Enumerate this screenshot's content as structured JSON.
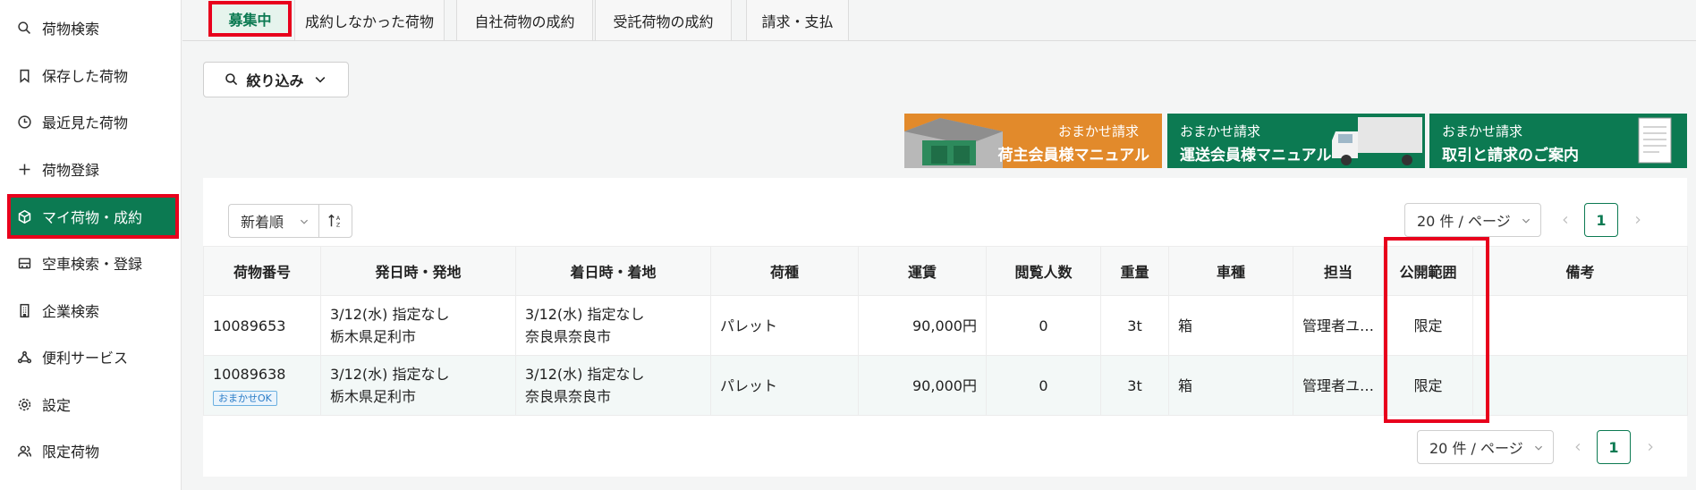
{
  "sidebar": {
    "items": [
      {
        "label": "荷物検索",
        "icon": "search-icon"
      },
      {
        "label": "保存した荷物",
        "icon": "bookmark-icon"
      },
      {
        "label": "最近見た荷物",
        "icon": "clock-icon"
      },
      {
        "label": "荷物登録",
        "icon": "plus-icon"
      },
      {
        "label": "マイ荷物・成約",
        "icon": "box-icon"
      },
      {
        "label": "空車検索・登録",
        "icon": "truck-icon"
      },
      {
        "label": "企業検索",
        "icon": "building-icon"
      },
      {
        "label": "便利サービス",
        "icon": "network-icon"
      },
      {
        "label": "設定",
        "icon": "gear-icon"
      },
      {
        "label": "限定荷物",
        "icon": "people-icon"
      }
    ]
  },
  "tabs": [
    "募集中",
    "成約しなかった荷物",
    "自社荷物の成約",
    "受託荷物の成約",
    "請求・支払"
  ],
  "filter": {
    "label": "絞り込み"
  },
  "banners": [
    {
      "line1": "おまかせ請求",
      "line2": "荷主会員様マニュアル"
    },
    {
      "line1": "おまかせ請求",
      "line2": "運送会員様マニュアル"
    },
    {
      "line1": "おまかせ請求",
      "line2": "取引と請求のご案内"
    }
  ],
  "sort": {
    "label": "新着順"
  },
  "pager": {
    "size_label": "20 件 / ページ",
    "current_page": "1"
  },
  "table": {
    "headers": [
      "荷物番号",
      "発日時・発地",
      "着日時・着地",
      "荷種",
      "運賃",
      "閲覧人数",
      "重量",
      "車種",
      "担当",
      "公開範囲",
      "備考"
    ],
    "rows": [
      {
        "id": "10089653",
        "badge": "",
        "dep_time": "3/12(水) 指定なし",
        "dep_place": "栃木県足利市",
        "arr_time": "3/12(水) 指定なし",
        "arr_place": "奈良県奈良市",
        "cargo": "パレット",
        "fare": "90,000円",
        "views": "0",
        "weight": "3t",
        "vehicle": "箱",
        "staff": "管理者ユ…",
        "scope": "限定",
        "note": ""
      },
      {
        "id": "10089638",
        "badge": "おまかせOK",
        "dep_time": "3/12(水) 指定なし",
        "dep_place": "栃木県足利市",
        "arr_time": "3/12(水) 指定なし",
        "arr_place": "奈良県奈良市",
        "cargo": "パレット",
        "fare": "90,000円",
        "views": "0",
        "weight": "3t",
        "vehicle": "箱",
        "staff": "管理者ユ…",
        "scope": "限定",
        "note": ""
      }
    ]
  },
  "colors": {
    "brand_green": "#0c7a52",
    "highlight_red": "#e8001c",
    "banner_orange": "#e28a2b"
  }
}
